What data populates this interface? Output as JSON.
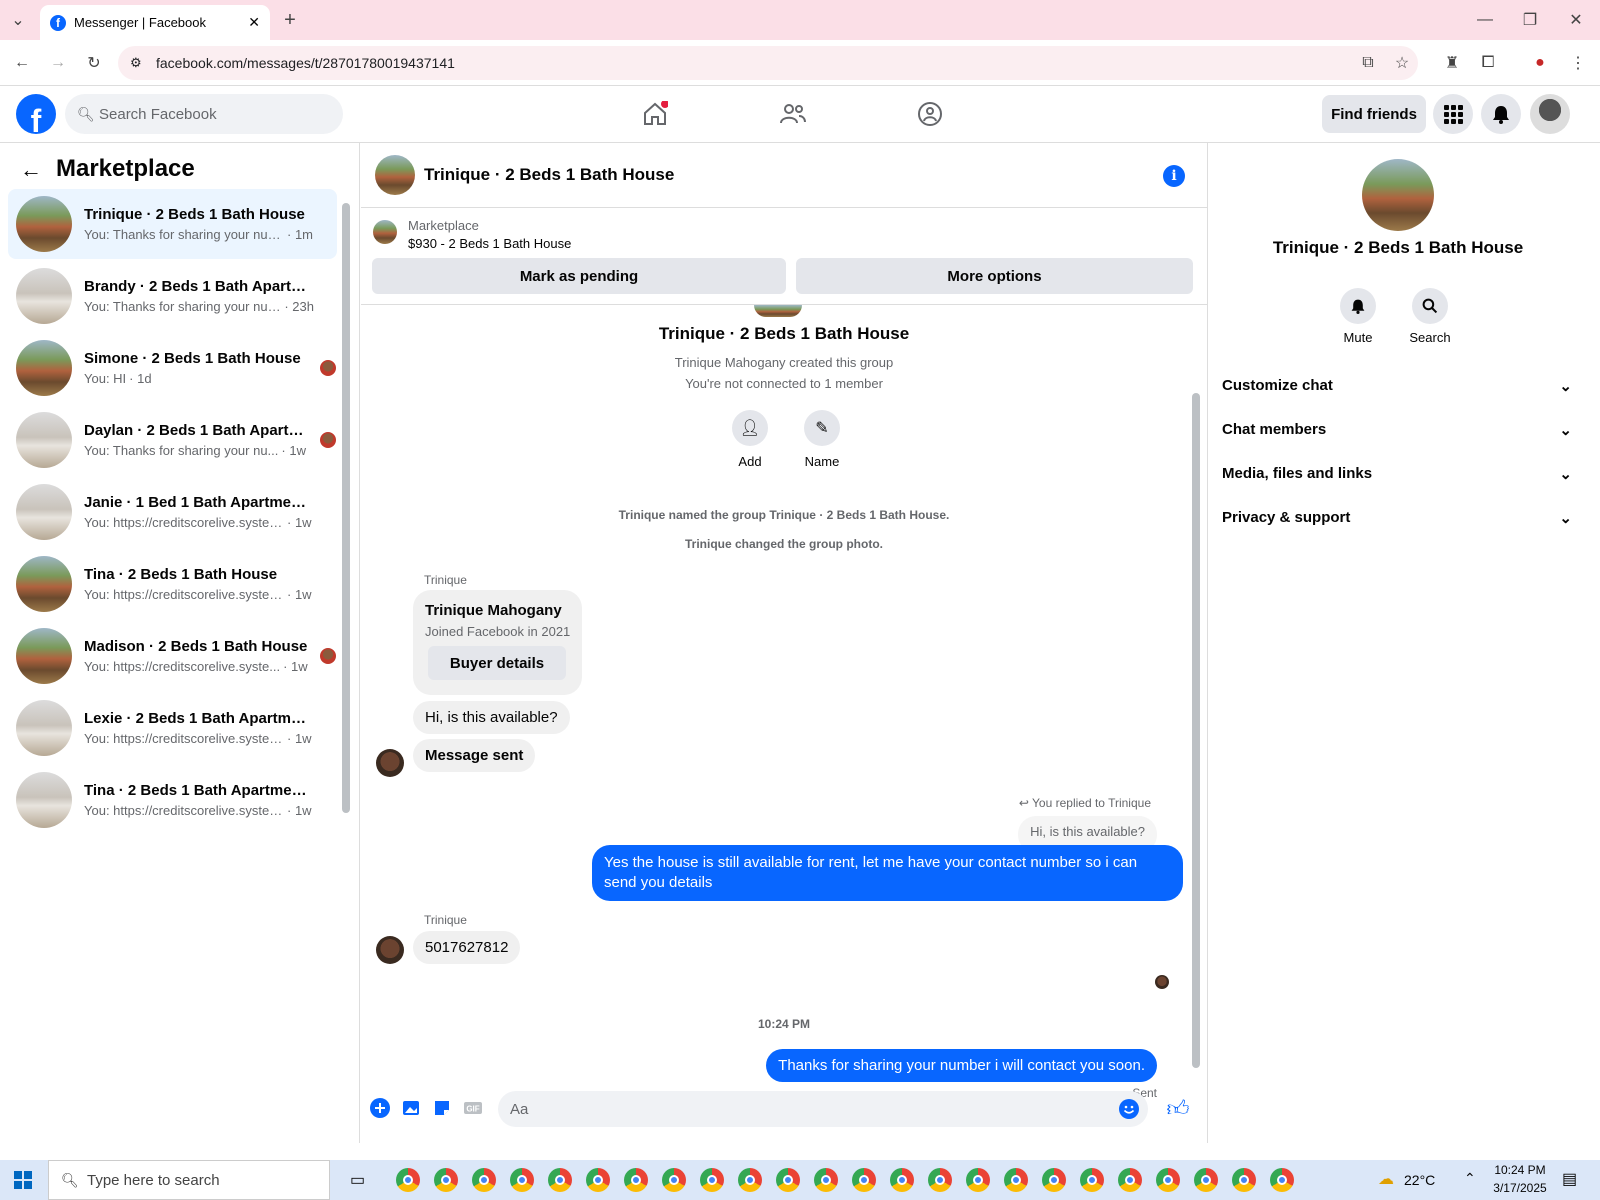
{
  "browser": {
    "tab_title": "Messenger | Facebook",
    "url": "facebook.com/messages/t/28701780019437141"
  },
  "header": {
    "search_placeholder": "Search Facebook",
    "find_friends": "Find friends"
  },
  "left": {
    "title": "Marketplace",
    "conversations": [
      {
        "name": "Trinique · 2 Beds 1 Bath House",
        "snippet": "You: Thanks for sharing your numb...",
        "time": "· 1m",
        "thumb": "house"
      },
      {
        "name": "Brandy · 2 Beds 1 Bath Apartme...",
        "snippet": "You: Thanks for sharing your num...",
        "time": "· 23h",
        "thumb": "room"
      },
      {
        "name": "Simone · 2 Beds 1 Bath House",
        "snippet": "You: HI",
        "time": "· 1d",
        "thumb": "house"
      },
      {
        "name": "Daylan · 2 Beds 1 Bath Apartm...",
        "snippet": "You: Thanks for sharing your nu...",
        "time": "· 1w",
        "thumb": "room"
      },
      {
        "name": "Janie · 1 Bed 1 Bath Apartment/c...",
        "snippet": "You: https://creditscorelive.system...",
        "time": "· 1w",
        "thumb": "room"
      },
      {
        "name": "Tina · 2 Beds 1 Bath House",
        "snippet": "You: https://creditscorelive.system...",
        "time": "· 1w",
        "thumb": "house"
      },
      {
        "name": "Madison · 2 Beds 1 Bath House",
        "snippet": "You: https://creditscorelive.syste...",
        "time": "· 1w",
        "thumb": "house"
      },
      {
        "name": "Lexie · 2 Beds 1 Bath Apartment/...",
        "snippet": "You: https://creditscorelive.system...",
        "time": "· 1w",
        "thumb": "room"
      },
      {
        "name": "Tina · 2 Beds 1 Bath Apartment/...",
        "snippet": "You: https://creditscorelive.system...",
        "time": "· 1w",
        "thumb": "room"
      }
    ]
  },
  "chat": {
    "title": "Trinique · 2 Beds 1 Bath House",
    "marketplace_label": "Marketplace",
    "listing": "$930 - 2 Beds 1 Bath House",
    "mark_pending": "Mark as pending",
    "more_options": "More options",
    "group_name": "Trinique · 2 Beds 1 Bath House",
    "created": "Trinique Mahogany created this group",
    "not_connected": "You're not connected to 1 member",
    "add": "Add",
    "name": "Name",
    "sys1": "Trinique named the group Trinique · 2 Beds 1 Bath House.",
    "sys2": "Trinique changed the group photo.",
    "sender1": "Trinique",
    "card_name": "Trinique Mahogany",
    "card_joined": "Joined Facebook in 2021",
    "buyer_details": "Buyer details",
    "msg1": "Hi, is this available?",
    "msg2": "Message sent",
    "replied": "You replied to Trinique",
    "quoted": "Hi, is this available?",
    "msg3": "Yes the house is still available for rent, let me have your contact number so i can send you details",
    "sender2": "Trinique",
    "msg4": "5017627812",
    "time": "10:24 PM",
    "msg5": "Thanks for sharing your number i will contact you soon.",
    "sent": "Sent",
    "input_placeholder": "Aa"
  },
  "right": {
    "name": "Trinique · 2 Beds 1 Bath House",
    "mute": "Mute",
    "search": "Search",
    "sections": [
      "Customize chat",
      "Chat members",
      "Media, files and links",
      "Privacy & support"
    ]
  },
  "taskbar": {
    "search": "Type here to search",
    "weather": "22°C",
    "time": "10:24 PM",
    "date": "3/17/2025"
  },
  "colors": {
    "accent": "#0866ff",
    "tabbar": "#fbdfe7"
  }
}
